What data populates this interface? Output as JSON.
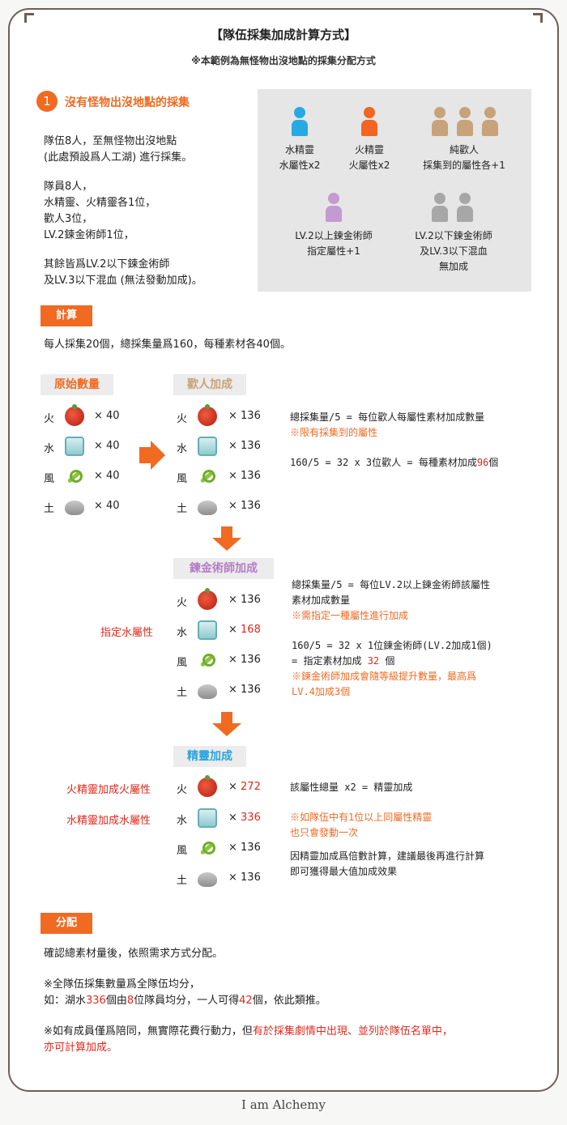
{
  "title": "【隊伍採集加成計算方式】",
  "subtitle": "※本範例為無怪物出沒地點的採集分配方式",
  "section1": {
    "num": "1",
    "heading": "沒有怪物出沒地點的採集",
    "p1a": "隊伍8人，至無怪物出沒地點",
    "p1b": "(此處預設爲人工湖) 進行採集。",
    "p2a": "隊員8人，",
    "p2b": "水精靈、火精靈各1位，",
    "p2c": "歡人3位，",
    "p2d": "LV.2鍊金術師1位，",
    "p3a": "其餘皆爲LV.2以下鍊金術師",
    "p3b": "及LV.3以下混血 (無法發動加成)。"
  },
  "groups": {
    "water": {
      "l1": "水精靈",
      "l2": "水屬性x2",
      "color": "#27aae1"
    },
    "fire": {
      "l1": "火精靈",
      "l2": "火屬性x2",
      "color": "#f26522"
    },
    "beast": {
      "l1": "純歡人",
      "l2": "採集到的屬性各+1",
      "color": "#c8a27a"
    },
    "alch": {
      "l1": "LV.2以上鍊金術師",
      "l2": "指定屬性+1",
      "color": "#c59ad0"
    },
    "mixed": {
      "l1": "LV.2以下鍊金術師",
      "l2": "及LV.3以下混血",
      "l3": "無加成",
      "color": "#a7a7a7"
    }
  },
  "calc": {
    "tag": "計算",
    "desc": "每人採集20個，總採集量爲160，每種素材各40個。"
  },
  "columns": {
    "orig": "原始數量",
    "beast": "歡人加成",
    "alch": "鍊金術師加成",
    "spirit": "精靈加成"
  },
  "elements": {
    "fire": "火",
    "water": "水",
    "wind": "風",
    "earth": "土"
  },
  "icons": {
    "fire": "fire-material-icon",
    "water": "water-material-icon",
    "wind": "wind-material-icon",
    "earth": "earth-material-icon"
  },
  "orig": {
    "fire": "× 40",
    "water": "× 40",
    "wind": "× 40",
    "earth": "× 40"
  },
  "beastq": {
    "fire": "× 136",
    "water": "× 136",
    "wind": "× 136",
    "earth": "× 136"
  },
  "alchq": {
    "fire": "× 136",
    "water_x": "× ",
    "water_v": "168",
    "wind": "× 136",
    "earth": "× 136",
    "note": "指定水屬性"
  },
  "spiritq": {
    "fire_x": "× ",
    "fire_v": "272",
    "water_x": "× ",
    "water_v": "336",
    "wind": "× 136",
    "earth": "× 136",
    "note_fire": "火精靈加成火屬性",
    "note_water": "水精靈加成水屬性"
  },
  "beastnote": {
    "l1": "總採集量/5 = 每位歡人每屬性素材加成數量",
    "l2": "※限有採集到的屬性",
    "l3a": "160/5 = 32 x 3位歡人 = 每種素材加成",
    "l3b": "96",
    "l3c": "個"
  },
  "alchnote": {
    "l1": "總採集量/5 = 每位LV.2以上鍊金術師該屬性",
    "l2": "素材加成數量",
    "l3": "※需指定一種屬性進行加成",
    "l4": "160/5 = 32 x 1位鍊金術師(LV.2加成1個)",
    "l5a": "= 指定素材加成 ",
    "l5b": "32",
    "l5c": " 個",
    "l6": "※鍊金術師加成會隨等級提升數量，最高爲",
    "l7": "LV.4加成3個"
  },
  "spiritnote": {
    "l1": "該屬性總量 x2 = 精靈加成",
    "l2": "※如隊伍中有1位以上同屬性精靈",
    "l3": "也只會發動一次",
    "l4": "因精靈加成爲倍數計算，建議最後再進行計算",
    "l5": "即可獲得最大值加成效果"
  },
  "dist": {
    "tag": "分配",
    "p1": "確認總素材量後，依照需求方式分配。",
    "p2": "※全隊伍採集數量爲全隊伍均分，",
    "p3a": "如：湖水",
    "p3b": "336",
    "p3c": "個由",
    "p3d": "8",
    "p3e": "位隊員均分，一人可得",
    "p3f": "42",
    "p3g": "個，依此類推。",
    "p4a": "※如有成員僅爲陪同，無實際花費行動力，但",
    "p4b": "有於採集劇情中出現、並列於隊伍名單中，",
    "p5": "亦可計算加成。"
  },
  "footer": "I am Alchemy"
}
